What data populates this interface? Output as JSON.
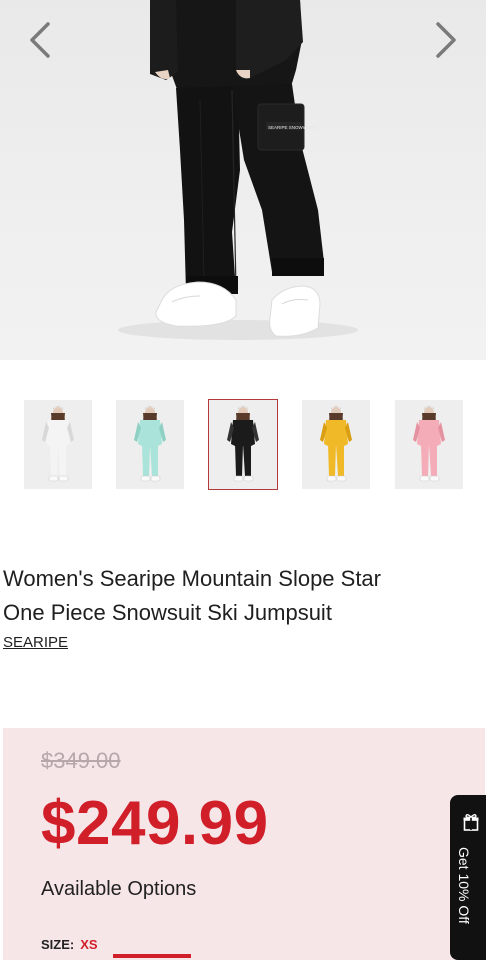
{
  "hero": {
    "prev_icon": "chevron-left-icon",
    "next_icon": "chevron-right-icon",
    "patch_text": "SEARIPE SNOWWEAR"
  },
  "thumbnails": [
    {
      "color": "white",
      "suit": "#f4f4f4",
      "accent": "#d8d8d8"
    },
    {
      "color": "mint",
      "suit": "#a9e3d9",
      "accent": "#8fd0c5"
    },
    {
      "color": "black",
      "suit": "#1b1b1b",
      "accent": "#333333"
    },
    {
      "color": "yellow",
      "suit": "#f0b928",
      "accent": "#d99e12"
    },
    {
      "color": "pink",
      "suit": "#f4adb8",
      "accent": "#e592a0"
    }
  ],
  "selected_thumbnail": 2,
  "product": {
    "title_line1": "Women's Searipe Mountain Slope Star",
    "title_line2": "One Piece Snowsuit Ski Jumpsuit",
    "brand": "SEARIPE"
  },
  "pricing": {
    "old_price": "$349.00",
    "new_price": "$249.99",
    "options_label": "Available Options",
    "size_label": "SIZE:",
    "size_value": "XS"
  },
  "side_tab": {
    "text": "Get 10% Off",
    "icon": "gift-icon"
  },
  "colors": {
    "accent_red": "#d11f2a",
    "price_box_bg": "#f7e6e8",
    "selected_outline": "#b33a3a"
  }
}
